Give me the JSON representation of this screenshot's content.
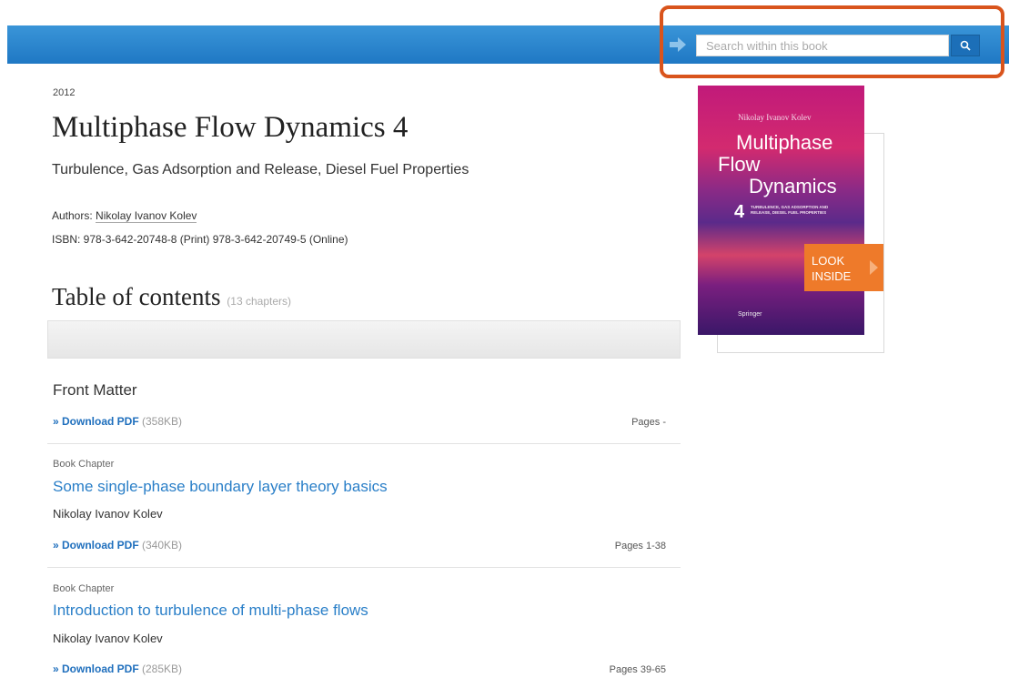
{
  "header": {
    "search_placeholder": "Search within this book",
    "accent_color": "#2a86cf",
    "highlight_color": "#d9541c"
  },
  "book": {
    "year": "2012",
    "title": "Multiphase Flow Dynamics 4",
    "subtitle": "Turbulence, Gas Adsorption and Release, Diesel Fuel Properties",
    "authors_label": "Authors:",
    "author_name": "Nikolay Ivanov Kolev",
    "isbn_text": "ISBN: 978-3-642-20748-8 (Print) 978-3-642-20749-5 (Online)"
  },
  "toc": {
    "heading": "Table of contents",
    "count": "(13 chapters)",
    "download_label": "» Download PDF",
    "entries": [
      {
        "kind": "",
        "title": "Front Matter",
        "author": "",
        "size": "(358KB)",
        "pages": "Pages -"
      },
      {
        "kind": "Book Chapter",
        "title": "Some single-phase boundary layer theory basics",
        "author": "Nikolay Ivanov Kolev",
        "size": "(340KB)",
        "pages": "Pages 1-38"
      },
      {
        "kind": "Book Chapter",
        "title": "Introduction to turbulence of multi-phase flows",
        "author": "Nikolay Ivanov Kolev",
        "size": "(285KB)",
        "pages": "Pages 39-65"
      }
    ]
  },
  "cover": {
    "author": "Nikolay Ivanov Kolev",
    "title_line1": "Multiphase",
    "title_line2": "Flow",
    "title_line3": "Dynamics",
    "volume": "4",
    "subtitle": "TURBULENCE, GAS ADSORPTION AND RELEASE, DIESEL FUEL PROPERTIES",
    "publisher": "Springer",
    "look_inside_line1": "LOOK",
    "look_inside_line2": "INSIDE"
  }
}
